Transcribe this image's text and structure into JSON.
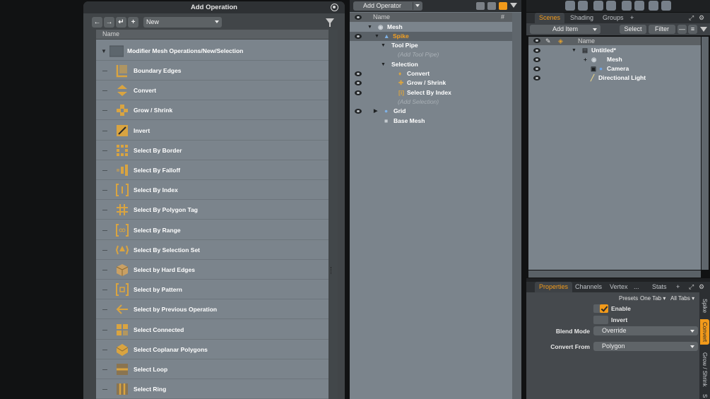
{
  "dialog": {
    "title": "Add Operation",
    "preset_value": "New",
    "column_name": "Name",
    "group_label": "Modifier Mesh Operations/New/Selection",
    "items": [
      {
        "label": "Boundary Edges",
        "icon": "boundary-edges-icon"
      },
      {
        "label": "Convert",
        "icon": "convert-icon"
      },
      {
        "label": "Grow / Shrink",
        "icon": "grow-shrink-icon"
      },
      {
        "label": "Invert",
        "icon": "invert-icon"
      },
      {
        "label": "Select By Border",
        "icon": "select-by-border-icon"
      },
      {
        "label": "Select By Falloff",
        "icon": "select-by-falloff-icon"
      },
      {
        "label": "Select By Index",
        "icon": "select-by-index-icon"
      },
      {
        "label": "Select By Polygon Tag",
        "icon": "polygon-tag-icon"
      },
      {
        "label": "Select By Range",
        "icon": "select-by-range-icon"
      },
      {
        "label": "Select By Selection Set",
        "icon": "selection-set-icon"
      },
      {
        "label": "Select by Hard Edges",
        "icon": "hard-edges-icon"
      },
      {
        "label": "Select by Pattern",
        "icon": "pattern-icon"
      },
      {
        "label": "Select by Previous Operation",
        "icon": "previous-operation-icon"
      },
      {
        "label": "Select Connected",
        "icon": "select-connected-icon"
      },
      {
        "label": "Select Coplanar Polygons",
        "icon": "coplanar-icon"
      },
      {
        "label": "Select Loop",
        "icon": "select-loop-icon"
      },
      {
        "label": "Select Ring",
        "icon": "select-ring-icon"
      }
    ]
  },
  "mesh_ops": {
    "add_operator_label": "Add Operator",
    "col_name": "Name",
    "col_hash": "#",
    "tree": {
      "mesh": "Mesh",
      "spike": "Spike",
      "tool_pipe": "Tool Pipe",
      "add_tool_pipe": "(Add Tool Pipe)",
      "selection": "Selection",
      "convert": "Convert",
      "grow_shrink": "Grow / Shrink",
      "select_by_index": "Select By Index",
      "add_selection": "(Add Selection)",
      "grid": "Grid",
      "base_mesh": "Base Mesh"
    }
  },
  "scene": {
    "tabs": [
      "Scenes",
      "Shading",
      "Groups",
      "+"
    ],
    "add_item_label": "Add Item",
    "select_label": "Select",
    "filter_label": "Filter",
    "col_name": "Name",
    "items": {
      "root": "Untitled*",
      "mesh": "Mesh",
      "camera": "Camera",
      "light": "Directional Light"
    }
  },
  "properties": {
    "tabs": [
      "Properties",
      "Channels",
      "Vertex",
      "...",
      "Stats",
      "+"
    ],
    "presets_label": "Presets",
    "one_tab": "One Tab",
    "all_tabs": "All Tabs",
    "enable_label": "Enable",
    "enable_checked": true,
    "invert_label": "Invert",
    "invert_checked": false,
    "blend_mode_label": "Blend Mode",
    "blend_mode_value": "Override",
    "convert_from_label": "Convert From",
    "convert_from_value": "Polygon",
    "vertical_tabs": [
      "Spike",
      "Convert",
      "Grow / Shrink",
      "S"
    ]
  },
  "colors": {
    "accent": "#f29a1a",
    "panel": "#7b848c",
    "icon_gold": "#d9a441"
  }
}
